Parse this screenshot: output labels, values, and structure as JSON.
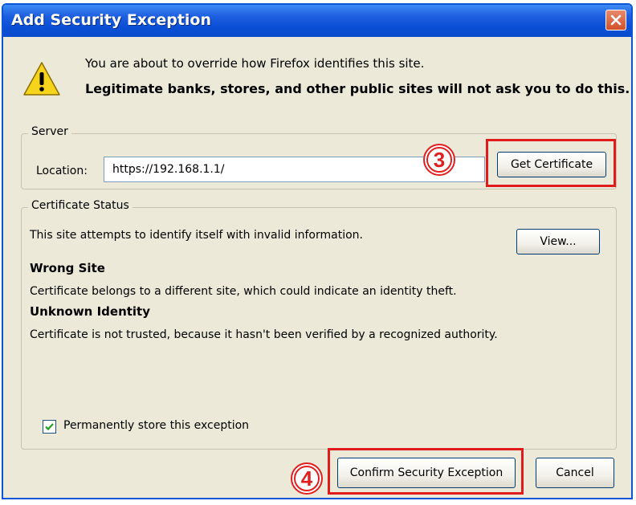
{
  "dialog": {
    "title": "Add Security Exception",
    "intro_line1": "You are about to override how Firefox identifies this site.",
    "intro_line2": "Legitimate banks, stores, and other public sites will not ask you to do this."
  },
  "server": {
    "legend": "Server",
    "location_label": "Location:",
    "location_value": "https://192.168.1.1/",
    "get_certificate_label": "Get Certificate"
  },
  "certificate_status": {
    "legend": "Certificate Status",
    "summary": "This site attempts to identify itself with invalid information.",
    "view_label": "View...",
    "issues": [
      {
        "heading": "Wrong Site",
        "detail": "Certificate belongs to a different site, which could indicate an identity theft."
      },
      {
        "heading": "Unknown Identity",
        "detail": "Certificate is not trusted, because it hasn't been verified by a recognized authority."
      }
    ],
    "permanent_label": "Permanently store this exception",
    "permanent_checked": true
  },
  "buttons": {
    "confirm_label": "Confirm Security Exception",
    "cancel_label": "Cancel"
  },
  "annotations": {
    "step_get_certificate": "3",
    "step_confirm": "4",
    "highlight_color": "#e01b1b"
  },
  "icons": {
    "warning": "warning-triangle-icon",
    "close": "close-icon",
    "check": "checkmark-icon"
  },
  "colors": {
    "titlebar": "#0a4fd6",
    "dialog_bg": "#ece9d8",
    "close_button": "#d2512a"
  }
}
